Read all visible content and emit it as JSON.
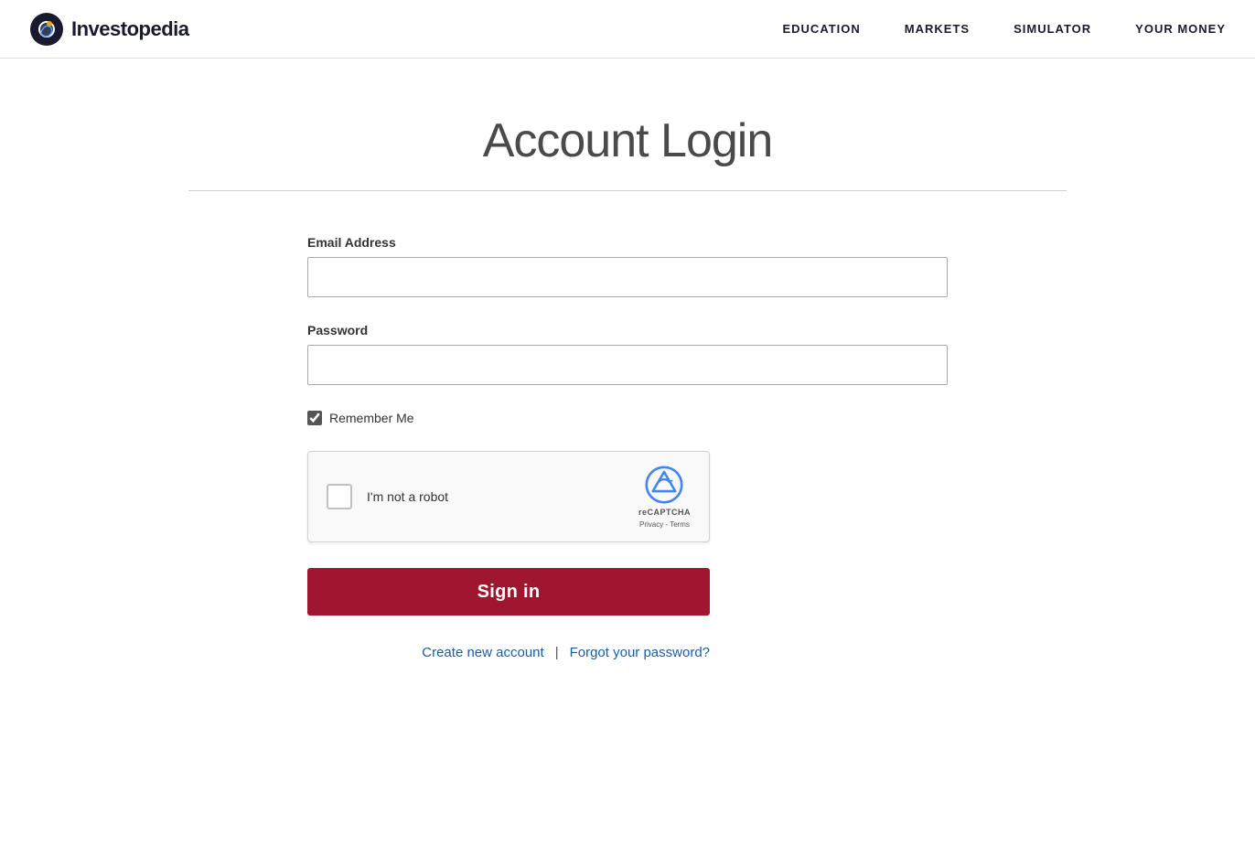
{
  "header": {
    "logo_text": "Investopedia",
    "nav": [
      {
        "label": "EDUCATION",
        "id": "education"
      },
      {
        "label": "MARKETS",
        "id": "markets"
      },
      {
        "label": "SIMULATOR",
        "id": "simulator"
      },
      {
        "label": "YOUR MONEY",
        "id": "your-money"
      }
    ]
  },
  "page": {
    "title": "Account Login",
    "divider": true
  },
  "form": {
    "email_label": "Email Address",
    "email_placeholder": "",
    "password_label": "Password",
    "password_placeholder": "",
    "remember_me_label": "Remember Me",
    "remember_me_checked": true,
    "recaptcha_text": "I'm not a robot",
    "recaptcha_label": "reCAPTCHA",
    "recaptcha_links": "Privacy - Terms",
    "sign_in_label": "Sign in"
  },
  "footer_links": {
    "create_account": "Create new account",
    "forgot_password": "Forgot your password?",
    "divider": "|"
  },
  "colors": {
    "accent": "#a01530",
    "link": "#1a5ea8",
    "nav_text": "#1a1a2e"
  }
}
